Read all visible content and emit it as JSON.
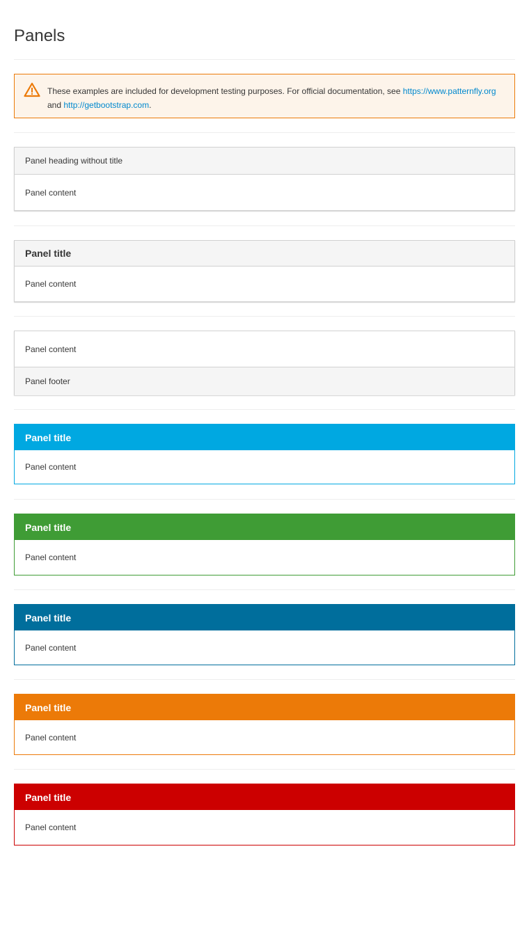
{
  "page": {
    "title": "Panels"
  },
  "alert": {
    "text_before": "These examples are included for development testing purposes. For official documentation, see ",
    "link1": "https://www.patternfly.org",
    "text_mid": " and ",
    "link2": "http://getbootstrap.com",
    "text_after": ".",
    "icon": "warning-triangle-icon",
    "colors": {
      "background": "#fdf4ea",
      "border": "#ec7a08",
      "link": "#0088ce"
    }
  },
  "panels": [
    {
      "kind": "heading-no-title",
      "heading": "Panel heading without title",
      "content": "Panel content"
    },
    {
      "kind": "with-title",
      "title": "Panel title",
      "content": "Panel content"
    },
    {
      "kind": "with-footer",
      "content": "Panel content",
      "footer": "Panel footer"
    },
    {
      "kind": "primary",
      "title": "Panel title",
      "content": "Panel content",
      "color": "#00a8e1"
    },
    {
      "kind": "success",
      "title": "Panel title",
      "content": "Panel content",
      "color": "#3f9c35"
    },
    {
      "kind": "info",
      "title": "Panel title",
      "content": "Panel content",
      "color": "#006e9c"
    },
    {
      "kind": "warning",
      "title": "Panel title",
      "content": "Panel content",
      "color": "#ec7a08"
    },
    {
      "kind": "danger",
      "title": "Panel title",
      "content": "Panel content",
      "color": "#cc0000"
    }
  ]
}
